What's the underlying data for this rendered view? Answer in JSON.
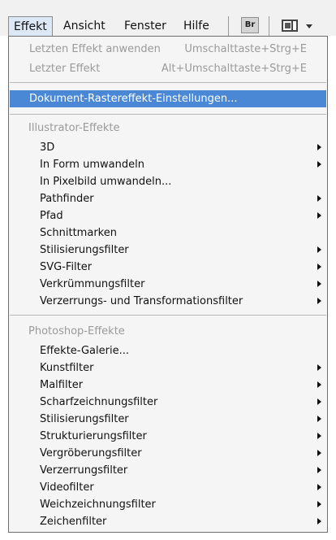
{
  "menubar": {
    "items": [
      {
        "label": "Effekt",
        "active": true
      },
      {
        "label": "Ansicht"
      },
      {
        "label": "Fenster"
      },
      {
        "label": "Hilfe"
      }
    ],
    "bridge_button": "Br"
  },
  "menu": {
    "top_items": [
      {
        "label": "Letzten Effekt anwenden",
        "shortcut": "Umschalttaste+Strg+E",
        "enabled": false
      },
      {
        "label": "Letzter Effekt",
        "shortcut": "Alt+Umschalttaste+Strg+E",
        "enabled": false
      }
    ],
    "highlighted_item": "Dokument-Rastereffekt-Einstellungen...",
    "illustrator": {
      "title": "Illustrator-Effekte",
      "items": [
        {
          "label": "3D",
          "submenu": true
        },
        {
          "label": "In Form umwandeln",
          "submenu": true
        },
        {
          "label": "In Pixelbild umwandeln...",
          "submenu": false
        },
        {
          "label": "Pathfinder",
          "submenu": true
        },
        {
          "label": "Pfad",
          "submenu": true
        },
        {
          "label": "Schnittmarken",
          "submenu": false
        },
        {
          "label": "Stilisierungsfilter",
          "submenu": true
        },
        {
          "label": "SVG-Filter",
          "submenu": true
        },
        {
          "label": "Verkrümmungsfilter",
          "submenu": true
        },
        {
          "label": "Verzerrungs- und Transformationsfilter",
          "submenu": true
        }
      ]
    },
    "photoshop": {
      "title": "Photoshop-Effekte",
      "items": [
        {
          "label": "Effekte-Galerie...",
          "submenu": false
        },
        {
          "label": "Kunstfilter",
          "submenu": true
        },
        {
          "label": "Malfilter",
          "submenu": true
        },
        {
          "label": "Scharfzeichnungsfilter",
          "submenu": true
        },
        {
          "label": "Stilisierungsfilter",
          "submenu": true
        },
        {
          "label": "Strukturierungsfilter",
          "submenu": true
        },
        {
          "label": "Vergröberungsfilter",
          "submenu": true
        },
        {
          "label": "Verzerrungsfilter",
          "submenu": true
        },
        {
          "label": "Videofilter",
          "submenu": true
        },
        {
          "label": "Weichzeichnungsfilter",
          "submenu": true
        },
        {
          "label": "Zeichenfilter",
          "submenu": true
        }
      ]
    }
  },
  "colors": {
    "highlight": "#4a88d6",
    "disabled_text": "#9a9a9a",
    "menu_background": "#f5f5f5"
  }
}
